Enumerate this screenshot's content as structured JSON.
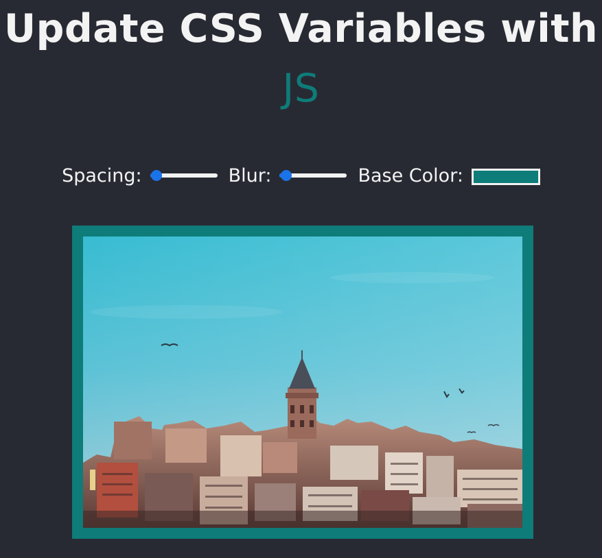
{
  "header": {
    "title_main": "Update CSS Variables with",
    "title_highlight": "JS"
  },
  "colors": {
    "background": "#282a33",
    "base": "#0e7c79",
    "slider_accent": "#1a73e8",
    "text": "#f3f3f3"
  },
  "controls": {
    "spacing_label": "Spacing:",
    "spacing_value": 0.1,
    "blur_label": "Blur:",
    "blur_value": 0.1,
    "base_color_label": "Base Color:",
    "base_color_value": "#0e7c79"
  },
  "image": {
    "subject": "city skyline with tower under blue sky"
  }
}
